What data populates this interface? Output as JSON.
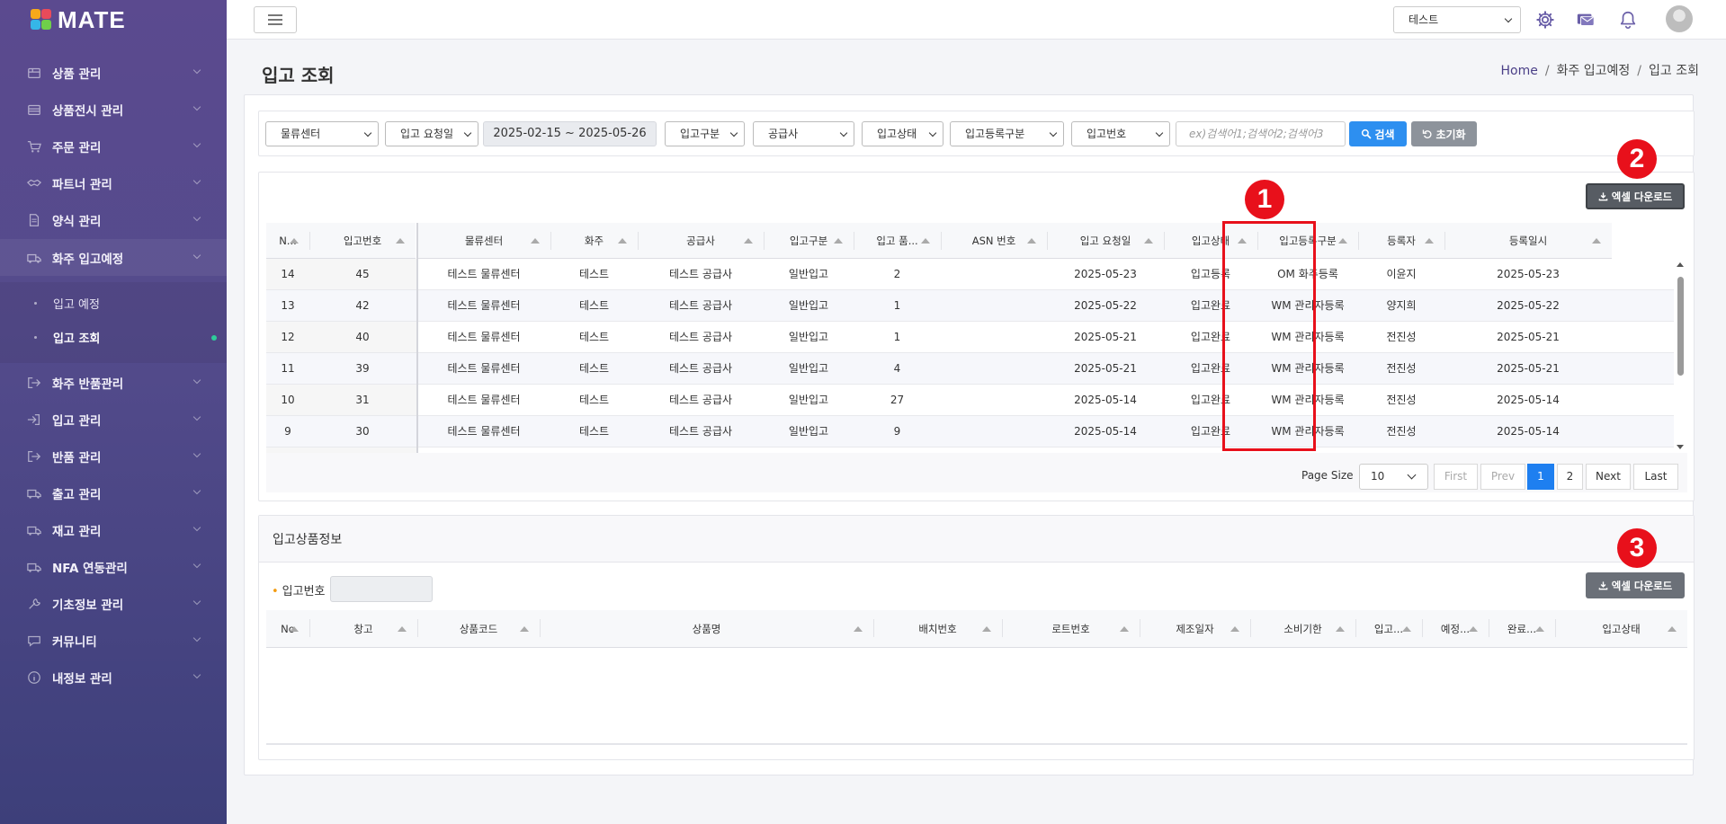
{
  "app": {
    "title": "MATE"
  },
  "sidebar": {
    "items": [
      {
        "label": "상품 관리",
        "icon": "box-icon"
      },
      {
        "label": "상품전시 관리",
        "icon": "storefront-icon"
      },
      {
        "label": "주문 관리",
        "icon": "cart-icon"
      },
      {
        "label": "파트너 관리",
        "icon": "handshake-icon"
      },
      {
        "label": "양식 관리",
        "icon": "document-icon"
      },
      {
        "label": "화주 입고예정",
        "icon": "truck-icon"
      },
      {
        "label": "화주 반품관리",
        "icon": "exit-icon"
      },
      {
        "label": "입고 관리",
        "icon": "enter-icon"
      },
      {
        "label": "반품 관리",
        "icon": "exit-icon"
      },
      {
        "label": "출고 관리",
        "icon": "truck-icon"
      },
      {
        "label": "재고 관리",
        "icon": "truck-icon"
      },
      {
        "label": "NFA 연동관리",
        "icon": "truck-icon"
      },
      {
        "label": "기초정보 관리",
        "icon": "wrench-icon"
      },
      {
        "label": "커뮤니티",
        "icon": "chat-icon"
      },
      {
        "label": "내정보 관리",
        "icon": "info-icon"
      }
    ],
    "sub_items": [
      {
        "label": "입고 예정"
      },
      {
        "label": "입고 조회"
      }
    ]
  },
  "topbar": {
    "company_select": "테스트",
    "icons": [
      "gear-icon",
      "message-icon",
      "bell-icon",
      "avatar"
    ]
  },
  "page": {
    "title": "입고 조회",
    "breadcrumb": [
      "Home",
      "화주 입고예정",
      "입고 조회"
    ]
  },
  "filters": {
    "center": "물류센터",
    "date_type": "입고 요청일",
    "date_range": "2025-02-15 ~ 2025-05-26",
    "inbound_type": "입고구분",
    "supplier": "공급사",
    "status": "입고상태",
    "reg_type": "입고등록구분",
    "inbound_no": "입고번호",
    "keyword_placeholder": "ex)검색어1;검색어2;검색어3",
    "search_label": "검색",
    "reset_label": "초기화"
  },
  "excel_label": "엑셀 다운로드",
  "badges": [
    "1",
    "2",
    "3"
  ],
  "grid1": {
    "columns": [
      "N...",
      "입고번호",
      "물류센터",
      "화주",
      "공급사",
      "입고구분",
      "입고 품...",
      "ASN 번호",
      "입고 요청일",
      "입고상태",
      "입고등록구분",
      "등록자",
      "등록일시"
    ],
    "rows": [
      [
        "14",
        "45",
        "테스트 물류센터",
        "테스트",
        "테스트 공급사",
        "일반입고",
        "2",
        "",
        "2025-05-23",
        "입고등록",
        "OM 화주등록",
        "이윤지",
        "2025-05-23"
      ],
      [
        "13",
        "42",
        "테스트 물류센터",
        "테스트",
        "테스트 공급사",
        "일반입고",
        "1",
        "",
        "2025-05-22",
        "입고완료",
        "WM 관리자등록",
        "양지희",
        "2025-05-22"
      ],
      [
        "12",
        "40",
        "테스트 물류센터",
        "테스트",
        "테스트 공급사",
        "일반입고",
        "1",
        "",
        "2025-05-21",
        "입고완료",
        "WM 관리자등록",
        "전진성",
        "2025-05-21"
      ],
      [
        "11",
        "39",
        "테스트 물류센터",
        "테스트",
        "테스트 공급사",
        "일반입고",
        "4",
        "",
        "2025-05-21",
        "입고완료",
        "WM 관리자등록",
        "전진성",
        "2025-05-21"
      ],
      [
        "10",
        "31",
        "테스트 물류센터",
        "테스트",
        "테스트 공급사",
        "일반입고",
        "27",
        "",
        "2025-05-14",
        "입고완료",
        "WM 관리자등록",
        "전진성",
        "2025-05-14"
      ],
      [
        "9",
        "30",
        "테스트 물류센터",
        "테스트",
        "테스트 공급사",
        "일반입고",
        "9",
        "",
        "2025-05-14",
        "입고완료",
        "WM 관리자등록",
        "전진성",
        "2025-05-14"
      ]
    ]
  },
  "pager": {
    "page_size_label": "Page Size",
    "page_size": "10",
    "first": "First",
    "prev": "Prev",
    "pages": [
      "1",
      "2"
    ],
    "next": "Next",
    "last": "Last"
  },
  "panel2": {
    "title": "입고상품정보",
    "inbound_no_label": "입고번호",
    "columns": [
      "No",
      "창고",
      "상품코드",
      "상품명",
      "배치번호",
      "로트번호",
      "제조일자",
      "소비기한",
      "입고...",
      "예정...",
      "완료...",
      "입고상태"
    ]
  },
  "colors": {
    "accent": "#2d8ff0",
    "highlight": "#e8101b",
    "sidebar": "#544b8c"
  }
}
